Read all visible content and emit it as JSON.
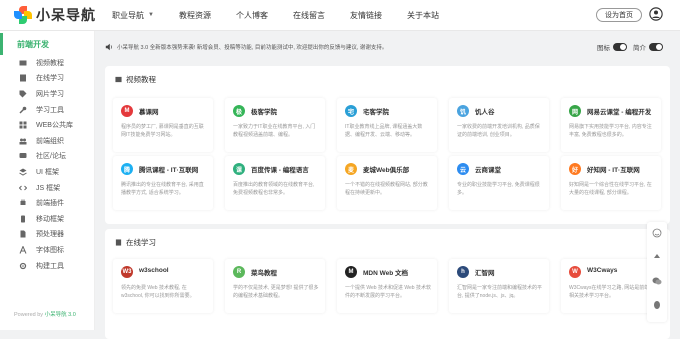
{
  "logo": {
    "text": "小呆导航"
  },
  "nav": [
    {
      "label": "职业导航",
      "dropdown": true
    },
    {
      "label": "教程资源"
    },
    {
      "label": "个人博客"
    },
    {
      "label": "在线留言"
    },
    {
      "label": "友情链接"
    },
    {
      "label": "关于本站"
    }
  ],
  "header": {
    "home_label": "设为首页",
    "user_icon": "user-circle-icon"
  },
  "sidebar": {
    "header": "前端开发",
    "items": [
      {
        "label": "视频教程",
        "icon": "video-icon"
      },
      {
        "label": "在线学习",
        "icon": "book-icon"
      },
      {
        "label": "网片学习",
        "icon": "tag-icon"
      },
      {
        "label": "学习工具",
        "icon": "wrench-icon"
      },
      {
        "label": "WEB公共库",
        "icon": "grid-icon"
      },
      {
        "label": "前端组织",
        "icon": "group-icon"
      },
      {
        "label": "社区/论坛",
        "icon": "chat-icon"
      },
      {
        "label": "UI 框架",
        "icon": "layers-icon"
      },
      {
        "label": "JS 框架",
        "icon": "code-icon"
      },
      {
        "label": "前端插件",
        "icon": "plug-icon"
      },
      {
        "label": "移动框架",
        "icon": "mobile-icon"
      },
      {
        "label": "预处理器",
        "icon": "file-icon"
      },
      {
        "label": "字体图标",
        "icon": "font-icon"
      },
      {
        "label": "构建工具",
        "icon": "gear-icon"
      }
    ],
    "footer_prefix": "Powered by ",
    "footer_link": "小呆导航 3.0"
  },
  "notice": {
    "text": "小呆导航 3.0 全新版本强势来袭! 新增会员、投稿等功能, 目前功能测试中, 欢迎提出你的反馈与建议, 谢谢支持。",
    "toggle_icon_label": "图标",
    "toggle_intro_label": "简介"
  },
  "sections": [
    {
      "title": "视频教程",
      "sites": [
        {
          "name": "慕课网",
          "desc": "程序员的梦工厂, 慕课网是垂直的互联网IT技能免费学习网站。",
          "color": "#e4393c",
          "glyph": "M"
        },
        {
          "name": "极客学院",
          "desc": "一家致力于IT职业在线教育平台, 入门教程视频涵盖前端、编程。",
          "color": "#35b558",
          "glyph": "极"
        },
        {
          "name": "宅客学院",
          "desc": "IT职业教育线上品牌, 课程涵盖大数据、编程开发、云端、移动等。",
          "color": "#2a9fd6",
          "glyph": "宅"
        },
        {
          "name": "饥人谷",
          "desc": "一家收费的前端开发培训机构, 品质保证的前端培训, 创业项目。",
          "color": "#4aa3df",
          "glyph": "饥"
        },
        {
          "name": "网易云课堂 - 编程开发",
          "desc": "网易旗下实用技能学习平台, 内容专注丰富, 免费教程也很多的。",
          "color": "#37a548",
          "glyph": "网"
        },
        {
          "name": "腾讯课程 - IT·互联网",
          "desc": "腾讯推出的专业在线教育平台, 采用直播教学方式, 适合系统学习。",
          "color": "#1db0f2",
          "glyph": "腾"
        },
        {
          "name": "百度传课 - 编程语言",
          "desc": "百度推出的教育领域的在线教育平台, 免费视频教程也非常多。",
          "color": "#2fb07e",
          "glyph": "课"
        },
        {
          "name": "麦城Web俱乐部",
          "desc": "一个不错的在线视频教程网站, 部分教程在持续更新中。",
          "color": "#f5a623",
          "glyph": "麦"
        },
        {
          "name": "云商课堂",
          "desc": "专业的职业技能学习平台, 免费课程很多。",
          "color": "#2d8cf0",
          "glyph": "云"
        },
        {
          "name": "好知网 - IT·互联网",
          "desc": "好知网是一个综合性在线学习平台, 在大量的在线课程, 部分课程。",
          "color": "#ff7a21",
          "glyph": "好"
        }
      ]
    },
    {
      "title": "在线学习",
      "sites": [
        {
          "name": "w3school",
          "desc": "领先的免费 Web 技术教程, 在 w3school, 你可以找到你所需要。",
          "color": "#c0392b",
          "glyph": "W3"
        },
        {
          "name": "菜鸟教程",
          "desc": "学的不仅是技术, 更是梦想! 提供了很多的编程技术基础教程。",
          "color": "#5cb85c",
          "glyph": "R"
        },
        {
          "name": "MDN Web 文档",
          "desc": "一个提供 Web 技术和促进 Web 技术软件的不断发展的学习平台。",
          "color": "#222222",
          "glyph": "M"
        },
        {
          "name": "汇智网",
          "desc": "汇智网是一家专注前端和编程技术的平台, 提供了node.js、js、jq。",
          "color": "#2c4a7a",
          "glyph": "h"
        },
        {
          "name": "W3Cways",
          "desc": "W3Cways在线学习之路, 网站是前端的相关技术学习平台。",
          "color": "#e74c3c",
          "glyph": "W"
        }
      ]
    }
  ],
  "float_icons": [
    "smile-icon",
    "top-icon",
    "wechat-icon",
    "qq-icon"
  ]
}
